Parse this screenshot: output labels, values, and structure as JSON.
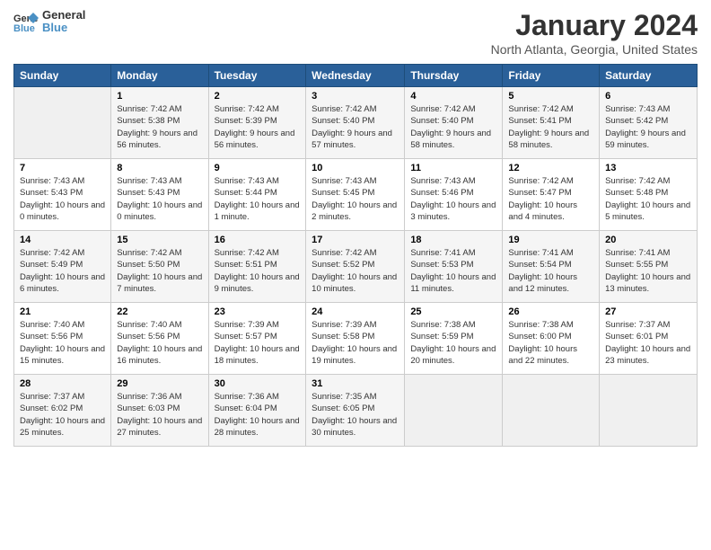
{
  "header": {
    "logo_line1": "General",
    "logo_line2": "Blue",
    "month": "January 2024",
    "location": "North Atlanta, Georgia, United States"
  },
  "weekdays": [
    "Sunday",
    "Monday",
    "Tuesday",
    "Wednesday",
    "Thursday",
    "Friday",
    "Saturday"
  ],
  "weeks": [
    [
      {
        "num": "",
        "sunrise": "",
        "sunset": "",
        "daylight": ""
      },
      {
        "num": "1",
        "sunrise": "Sunrise: 7:42 AM",
        "sunset": "Sunset: 5:38 PM",
        "daylight": "Daylight: 9 hours and 56 minutes."
      },
      {
        "num": "2",
        "sunrise": "Sunrise: 7:42 AM",
        "sunset": "Sunset: 5:39 PM",
        "daylight": "Daylight: 9 hours and 56 minutes."
      },
      {
        "num": "3",
        "sunrise": "Sunrise: 7:42 AM",
        "sunset": "Sunset: 5:40 PM",
        "daylight": "Daylight: 9 hours and 57 minutes."
      },
      {
        "num": "4",
        "sunrise": "Sunrise: 7:42 AM",
        "sunset": "Sunset: 5:40 PM",
        "daylight": "Daylight: 9 hours and 58 minutes."
      },
      {
        "num": "5",
        "sunrise": "Sunrise: 7:42 AM",
        "sunset": "Sunset: 5:41 PM",
        "daylight": "Daylight: 9 hours and 58 minutes."
      },
      {
        "num": "6",
        "sunrise": "Sunrise: 7:43 AM",
        "sunset": "Sunset: 5:42 PM",
        "daylight": "Daylight: 9 hours and 59 minutes."
      }
    ],
    [
      {
        "num": "7",
        "sunrise": "Sunrise: 7:43 AM",
        "sunset": "Sunset: 5:43 PM",
        "daylight": "Daylight: 10 hours and 0 minutes."
      },
      {
        "num": "8",
        "sunrise": "Sunrise: 7:43 AM",
        "sunset": "Sunset: 5:43 PM",
        "daylight": "Daylight: 10 hours and 0 minutes."
      },
      {
        "num": "9",
        "sunrise": "Sunrise: 7:43 AM",
        "sunset": "Sunset: 5:44 PM",
        "daylight": "Daylight: 10 hours and 1 minute."
      },
      {
        "num": "10",
        "sunrise": "Sunrise: 7:43 AM",
        "sunset": "Sunset: 5:45 PM",
        "daylight": "Daylight: 10 hours and 2 minutes."
      },
      {
        "num": "11",
        "sunrise": "Sunrise: 7:43 AM",
        "sunset": "Sunset: 5:46 PM",
        "daylight": "Daylight: 10 hours and 3 minutes."
      },
      {
        "num": "12",
        "sunrise": "Sunrise: 7:42 AM",
        "sunset": "Sunset: 5:47 PM",
        "daylight": "Daylight: 10 hours and 4 minutes."
      },
      {
        "num": "13",
        "sunrise": "Sunrise: 7:42 AM",
        "sunset": "Sunset: 5:48 PM",
        "daylight": "Daylight: 10 hours and 5 minutes."
      }
    ],
    [
      {
        "num": "14",
        "sunrise": "Sunrise: 7:42 AM",
        "sunset": "Sunset: 5:49 PM",
        "daylight": "Daylight: 10 hours and 6 minutes."
      },
      {
        "num": "15",
        "sunrise": "Sunrise: 7:42 AM",
        "sunset": "Sunset: 5:50 PM",
        "daylight": "Daylight: 10 hours and 7 minutes."
      },
      {
        "num": "16",
        "sunrise": "Sunrise: 7:42 AM",
        "sunset": "Sunset: 5:51 PM",
        "daylight": "Daylight: 10 hours and 9 minutes."
      },
      {
        "num": "17",
        "sunrise": "Sunrise: 7:42 AM",
        "sunset": "Sunset: 5:52 PM",
        "daylight": "Daylight: 10 hours and 10 minutes."
      },
      {
        "num": "18",
        "sunrise": "Sunrise: 7:41 AM",
        "sunset": "Sunset: 5:53 PM",
        "daylight": "Daylight: 10 hours and 11 minutes."
      },
      {
        "num": "19",
        "sunrise": "Sunrise: 7:41 AM",
        "sunset": "Sunset: 5:54 PM",
        "daylight": "Daylight: 10 hours and 12 minutes."
      },
      {
        "num": "20",
        "sunrise": "Sunrise: 7:41 AM",
        "sunset": "Sunset: 5:55 PM",
        "daylight": "Daylight: 10 hours and 13 minutes."
      }
    ],
    [
      {
        "num": "21",
        "sunrise": "Sunrise: 7:40 AM",
        "sunset": "Sunset: 5:56 PM",
        "daylight": "Daylight: 10 hours and 15 minutes."
      },
      {
        "num": "22",
        "sunrise": "Sunrise: 7:40 AM",
        "sunset": "Sunset: 5:56 PM",
        "daylight": "Daylight: 10 hours and 16 minutes."
      },
      {
        "num": "23",
        "sunrise": "Sunrise: 7:39 AM",
        "sunset": "Sunset: 5:57 PM",
        "daylight": "Daylight: 10 hours and 18 minutes."
      },
      {
        "num": "24",
        "sunrise": "Sunrise: 7:39 AM",
        "sunset": "Sunset: 5:58 PM",
        "daylight": "Daylight: 10 hours and 19 minutes."
      },
      {
        "num": "25",
        "sunrise": "Sunrise: 7:38 AM",
        "sunset": "Sunset: 5:59 PM",
        "daylight": "Daylight: 10 hours and 20 minutes."
      },
      {
        "num": "26",
        "sunrise": "Sunrise: 7:38 AM",
        "sunset": "Sunset: 6:00 PM",
        "daylight": "Daylight: 10 hours and 22 minutes."
      },
      {
        "num": "27",
        "sunrise": "Sunrise: 7:37 AM",
        "sunset": "Sunset: 6:01 PM",
        "daylight": "Daylight: 10 hours and 23 minutes."
      }
    ],
    [
      {
        "num": "28",
        "sunrise": "Sunrise: 7:37 AM",
        "sunset": "Sunset: 6:02 PM",
        "daylight": "Daylight: 10 hours and 25 minutes."
      },
      {
        "num": "29",
        "sunrise": "Sunrise: 7:36 AM",
        "sunset": "Sunset: 6:03 PM",
        "daylight": "Daylight: 10 hours and 27 minutes."
      },
      {
        "num": "30",
        "sunrise": "Sunrise: 7:36 AM",
        "sunset": "Sunset: 6:04 PM",
        "daylight": "Daylight: 10 hours and 28 minutes."
      },
      {
        "num": "31",
        "sunrise": "Sunrise: 7:35 AM",
        "sunset": "Sunset: 6:05 PM",
        "daylight": "Daylight: 10 hours and 30 minutes."
      },
      {
        "num": "",
        "sunrise": "",
        "sunset": "",
        "daylight": ""
      },
      {
        "num": "",
        "sunrise": "",
        "sunset": "",
        "daylight": ""
      },
      {
        "num": "",
        "sunrise": "",
        "sunset": "",
        "daylight": ""
      }
    ]
  ]
}
